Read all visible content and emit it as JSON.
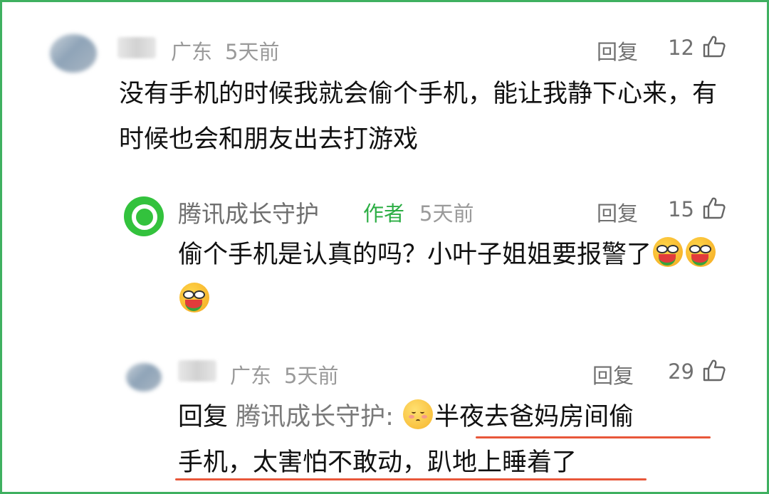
{
  "comments": [
    {
      "location": "广东",
      "time": "5天前",
      "reply_label": "回复",
      "likes": "12",
      "text": "没有手机的时候我就会偷个手机，能让我静下心来，有时候也会和朋友出去打游戏"
    },
    {
      "name": "腾讯成长守护",
      "author_tag": "作者",
      "time": "5天前",
      "reply_label": "回复",
      "likes": "15",
      "text": "偷个手机是认真的吗？小叶子姐姐要报警了",
      "emojis": [
        "melon-eating-emoji",
        "melon-eating-emoji",
        "melon-eating-emoji"
      ]
    },
    {
      "location": "广东",
      "time": "5天前",
      "reply_label": "回复",
      "likes": "29",
      "reply_prefix": "回复",
      "reply_target": "腾讯成长守护:",
      "emoji": "shy-smile-emoji",
      "text_line1": "半夜去爸妈房间偷",
      "text_line2": "手机，太害怕不敢动，趴地上睡着了"
    }
  ],
  "colors": {
    "author_green": "#2dae45",
    "brand_green": "#33c23d",
    "border_green": "#3fb060",
    "underline_red": "#e8573a"
  },
  "icons": {
    "like": "thumbs-up-icon"
  }
}
